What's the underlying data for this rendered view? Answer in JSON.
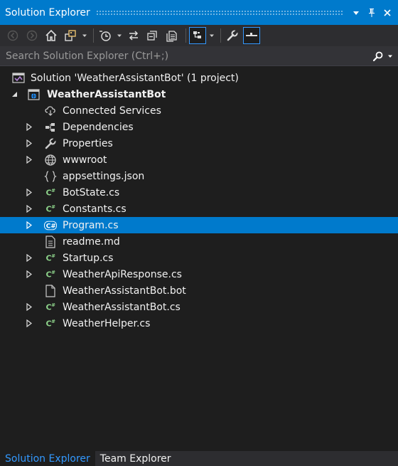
{
  "window": {
    "title": "Solution Explorer",
    "title_buttons": [
      "dropdown-icon",
      "pin-icon",
      "close-icon"
    ]
  },
  "toolbar": {
    "buttons": [
      {
        "icon": "back-icon",
        "enabled": false
      },
      {
        "icon": "forward-icon",
        "enabled": false
      },
      {
        "icon": "home-icon",
        "enabled": true
      },
      {
        "icon": "switch-views-icon",
        "enabled": true,
        "has_dropdown": true
      },
      {
        "icon": "pending-changes-filter-icon",
        "enabled": true,
        "has_dropdown": true
      },
      {
        "icon": "sync-with-active-document-icon",
        "enabled": true
      },
      {
        "icon": "collapse-all-icon",
        "enabled": true
      },
      {
        "icon": "show-all-files-icon",
        "enabled": true
      },
      {
        "icon": "preview-selected-items-icon",
        "enabled": true,
        "pressed": true,
        "has_dropdown": true
      },
      {
        "icon": "properties-wrench-icon",
        "enabled": true
      },
      {
        "icon": "active-document-preview-icon",
        "enabled": true,
        "pressed": true
      }
    ]
  },
  "search": {
    "placeholder": "Search Solution Explorer (Ctrl+;)",
    "value": ""
  },
  "tree": {
    "items": [
      {
        "label": "Solution 'WeatherAssistantBot' (1 project)",
        "icon": "solution-icon",
        "level": 0,
        "expander": "none",
        "bold": false
      },
      {
        "label": "WeatherAssistantBot",
        "icon": "web-project-icon",
        "level": 0,
        "expander": "expanded",
        "bold": true
      },
      {
        "label": "Connected Services",
        "icon": "connected-services-icon",
        "level": 1,
        "expander": "none"
      },
      {
        "label": "Dependencies",
        "icon": "dependencies-icon",
        "level": 1,
        "expander": "collapsed"
      },
      {
        "label": "Properties",
        "icon": "wrench-icon",
        "level": 1,
        "expander": "collapsed"
      },
      {
        "label": "wwwroot",
        "icon": "globe-icon",
        "level": 1,
        "expander": "collapsed"
      },
      {
        "label": "appsettings.json",
        "icon": "json-file-icon",
        "level": 1,
        "expander": "none"
      },
      {
        "label": "BotState.cs",
        "icon": "csharp-file-icon",
        "level": 1,
        "expander": "collapsed"
      },
      {
        "label": "Constants.cs",
        "icon": "csharp-file-icon",
        "level": 1,
        "expander": "collapsed"
      },
      {
        "label": "Program.cs",
        "icon": "csharp-file-icon",
        "level": 1,
        "expander": "collapsed",
        "selected": true
      },
      {
        "label": "readme.md",
        "icon": "text-file-icon",
        "level": 1,
        "expander": "none"
      },
      {
        "label": "Startup.cs",
        "icon": "csharp-file-icon",
        "level": 1,
        "expander": "collapsed"
      },
      {
        "label": "WeatherApiResponse.cs",
        "icon": "csharp-file-icon",
        "level": 1,
        "expander": "collapsed"
      },
      {
        "label": "WeatherAssistantBot.bot",
        "icon": "file-icon",
        "level": 1,
        "expander": "none"
      },
      {
        "label": "WeatherAssistantBot.cs",
        "icon": "csharp-file-icon",
        "level": 1,
        "expander": "collapsed"
      },
      {
        "label": "WeatherHelper.cs",
        "icon": "csharp-file-icon",
        "level": 1,
        "expander": "collapsed"
      }
    ]
  },
  "tabs": [
    {
      "label": "Solution Explorer",
      "active": true
    },
    {
      "label": "Team Explorer",
      "active": false
    }
  ],
  "colors": {
    "accent": "#007acc",
    "background": "#1e1e1e",
    "toolbar": "#2d2d30",
    "text": "#f1f1f1",
    "csharp_icon": "#8dd28a",
    "active_tab_text": "#3399ff"
  }
}
